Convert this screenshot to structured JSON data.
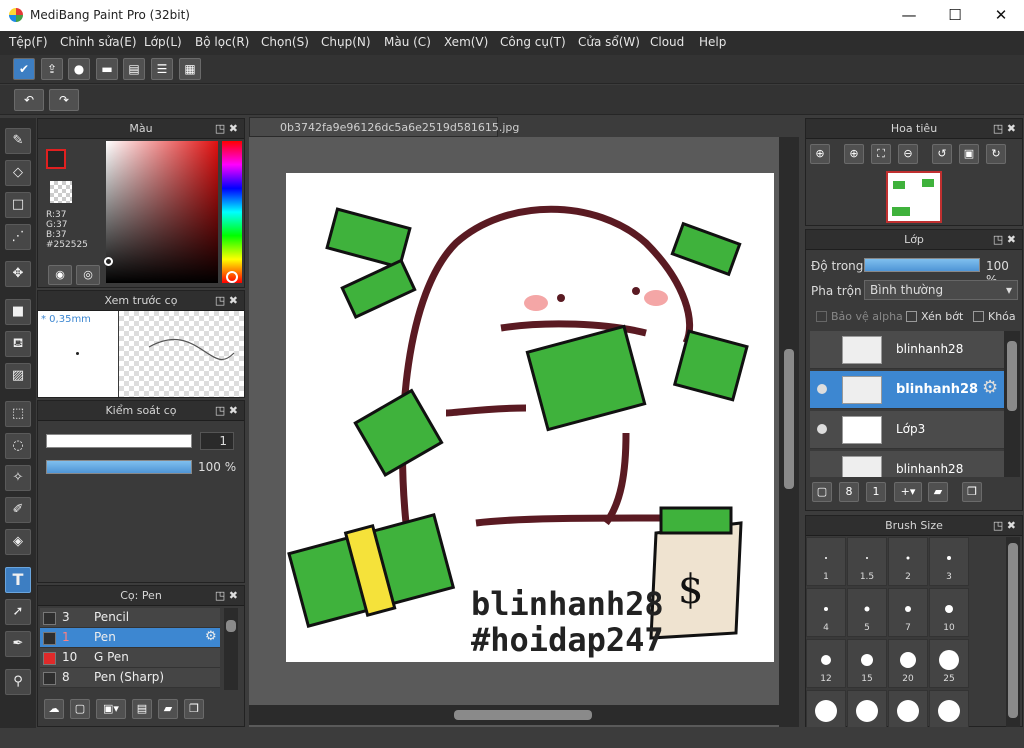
{
  "window": {
    "title": "MediBang Paint Pro (32bit)",
    "minimize": "—",
    "maximize": "☐",
    "close": "✕"
  },
  "menu": [
    "Tệp(F)",
    "Chỉnh sửa(E)",
    "Lớp(L)",
    "Bộ lọc(R)",
    "Chọn(S)",
    "Chụp(N)",
    "Màu (C)",
    "Xem(V)",
    "Công cụ(T)",
    "Cửa sổ(W)",
    "Cloud",
    "Help"
  ],
  "toolbar1": [
    "check-icon",
    "upload-icon",
    "speech-bubble-icon",
    "comment-icon",
    "page-icon",
    "list-icon",
    "grid-edit-icon"
  ],
  "toolbar2": [
    "undo-icon",
    "redo-icon"
  ],
  "document": {
    "tab": "0b3742fa9e96126dc5a6e2519d581615.jpg",
    "overlay_line1": "blinhanh28",
    "overlay_line2": "#hoidap247"
  },
  "color_panel": {
    "title": "Màu",
    "r": "R:37",
    "g": "G:37",
    "b": "B:37",
    "hex": "#252525",
    "fg": "#252525"
  },
  "brush_preview": {
    "title": "Xem trước cọ",
    "size": "* 0,35mm"
  },
  "brush_control": {
    "title": "Kiểm soát cọ",
    "size_value": "1",
    "opacity": "100 %",
    "opacity_level": 1.0
  },
  "brush_list": {
    "title": "Cọ: Pen",
    "items": [
      {
        "num": "3",
        "name": "Pencil",
        "color": "#2e2e2e"
      },
      {
        "num": "1",
        "name": "Pen",
        "color": "#2e2e2e",
        "selected": true
      },
      {
        "num": "10",
        "name": "G Pen",
        "color": "#e02a2a"
      },
      {
        "num": "8",
        "name": "Pen (Sharp)",
        "color": "#2e2e2e"
      }
    ]
  },
  "navigator": {
    "title": "Hoa tiêu"
  },
  "layers": {
    "title": "Lớp",
    "opacity_label": "Độ trong",
    "opacity_value": "100 %",
    "opacity_level": 1.0,
    "blend_label": "Pha trộn",
    "blend_value": "Bình thường",
    "protect_alpha": "Bảo vệ alpha",
    "clipping": "Xén bớt",
    "lock": "Khóa",
    "items": [
      {
        "name": "blinhanh28",
        "selected": false,
        "visible": false
      },
      {
        "name": "blinhanh28",
        "selected": true,
        "visible": true
      },
      {
        "name": "Lớp3",
        "selected": false,
        "visible": true
      },
      {
        "name": "blinhanh28",
        "selected": false,
        "visible": false
      }
    ]
  },
  "brush_size": {
    "title": "Brush Size",
    "sizes": [
      "1",
      "1.5",
      "2",
      "3",
      "4",
      "5",
      "7",
      "10",
      "12",
      "15",
      "20",
      "25",
      "",
      "",
      "",
      ""
    ]
  },
  "colors": {
    "accent": "#3d87d1",
    "panel_bg": "#3a3a3a",
    "canvas_bg": "#5a5a5a"
  }
}
